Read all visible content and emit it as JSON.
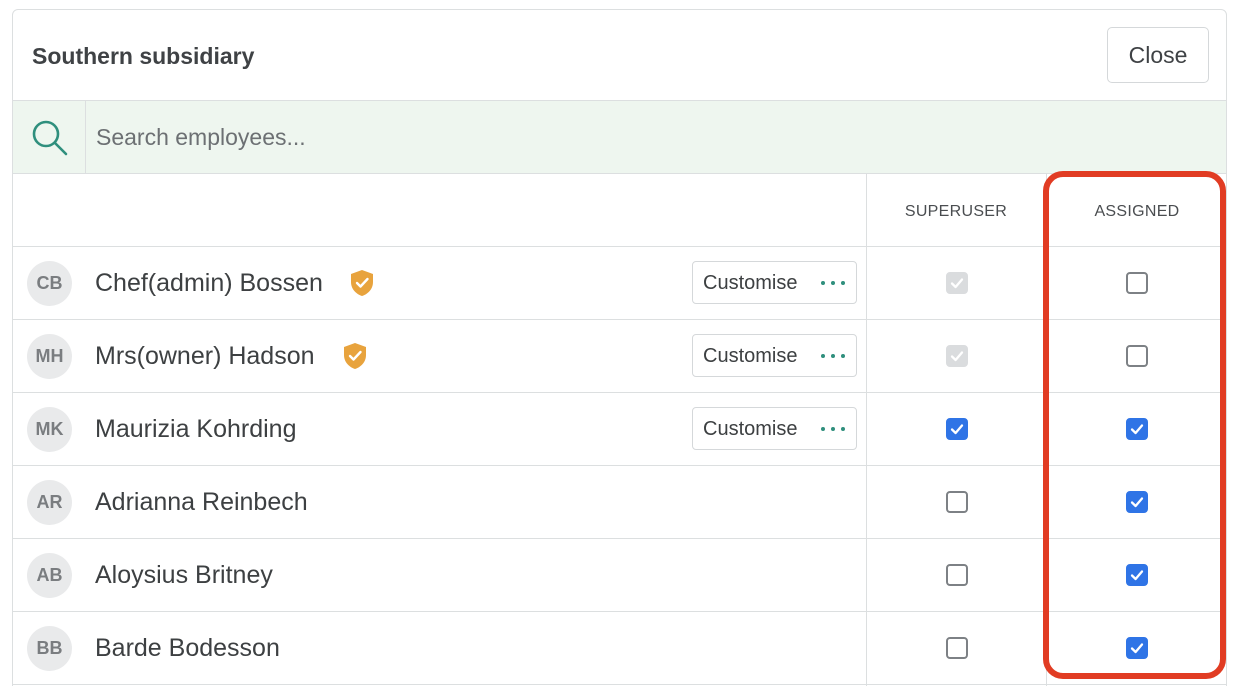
{
  "dialog": {
    "title": "Southern subsidiary",
    "close_label": "Close"
  },
  "search": {
    "placeholder": "Search employees...",
    "icon": "search-icon"
  },
  "columns": {
    "superuser": "SUPERUSER",
    "assigned": "ASSIGNED"
  },
  "customise_label": "Customise",
  "colors": {
    "accent": "#2f74e6",
    "teal": "#2f8f7d",
    "badge": "#e8a33d",
    "highlight": "#e13c23",
    "search_bg": "#eef6ef"
  },
  "employees": [
    {
      "initials": "CB",
      "name": "Chef(admin) Bossen",
      "badge": true,
      "customise": true,
      "superuser": "checked-disabled",
      "assigned": "unchecked"
    },
    {
      "initials": "MH",
      "name": "Mrs(owner) Hadson",
      "badge": true,
      "customise": true,
      "superuser": "checked-disabled",
      "assigned": "unchecked"
    },
    {
      "initials": "MK",
      "name": "Maurizia Kohrding",
      "badge": false,
      "customise": true,
      "superuser": "checked",
      "assigned": "checked"
    },
    {
      "initials": "AR",
      "name": "Adrianna Reinbech",
      "badge": false,
      "customise": false,
      "superuser": "unchecked",
      "assigned": "checked"
    },
    {
      "initials": "AB",
      "name": "Aloysius Britney",
      "badge": false,
      "customise": false,
      "superuser": "unchecked",
      "assigned": "checked"
    },
    {
      "initials": "BB",
      "name": "Barde Bodesson",
      "badge": false,
      "customise": false,
      "superuser": "unchecked",
      "assigned": "checked"
    }
  ]
}
